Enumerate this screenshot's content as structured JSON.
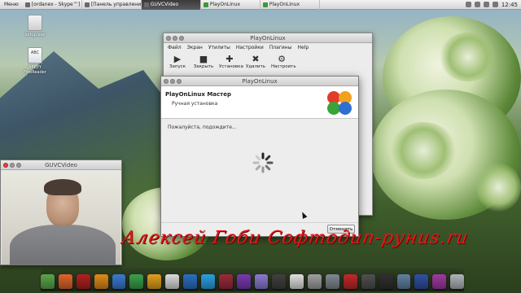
{
  "top_panel": {
    "menu_label": "Меню",
    "tasks": [
      {
        "label": "[ordanex - Skype™]",
        "active": false
      },
      {
        "label": "[Панель управлени...",
        "active": false
      },
      {
        "label": "GUVCVideo",
        "active": true
      },
      {
        "label": "PlayOnLinux",
        "active": false
      },
      {
        "label": "PlayOnLinux",
        "active": false
      }
    ],
    "clock": "12:45"
  },
  "desktop_icons": [
    {
      "label": "setup.exe",
      "color": "#e8e8e8"
    },
    {
      "label": "ABBYY FineReader",
      "color": "#dde3ea"
    }
  ],
  "pol_window": {
    "title": "PlayOnLinux",
    "menu": [
      "Файл",
      "Экран",
      "Утилиты",
      "Настройки",
      "Плагины",
      "Help"
    ],
    "toolbar": [
      {
        "label": "Запуск",
        "icon": "play-icon",
        "glyph": "▶"
      },
      {
        "label": "Закрыть",
        "icon": "stop-icon",
        "glyph": "■"
      },
      {
        "label": "Установка",
        "icon": "plus-icon",
        "glyph": "✚"
      },
      {
        "label": "Удалить",
        "icon": "remove-icon",
        "glyph": "✖"
      },
      {
        "label": "Настроить",
        "icon": "gear-icon",
        "glyph": "⚙"
      }
    ]
  },
  "wizard": {
    "window_title": "PlayOnLinux",
    "heading": "PlayOnLinux Мастер",
    "subheading": "Ручная установка",
    "message": "Пожалуйста, подождите...",
    "cancel_label": "Отменить"
  },
  "guvc_window": {
    "title": "GUVCVideo"
  },
  "watermark_text": "Алексей Гоби Софтодип-руниs.ru",
  "dock_items": [
    {
      "name": "anchor",
      "color": "#5aa64a"
    },
    {
      "name": "firefox",
      "color": "#e0642a"
    },
    {
      "name": "media",
      "color": "#b02020"
    },
    {
      "name": "clementine",
      "color": "#e08a1a"
    },
    {
      "name": "office-doc",
      "color": "#3a7ad0"
    },
    {
      "name": "spreadsheet",
      "color": "#3aa04a"
    },
    {
      "name": "presentation",
      "color": "#e0a020"
    },
    {
      "name": "document",
      "color": "#dcdcdc"
    },
    {
      "name": "mail",
      "color": "#2a70c0"
    },
    {
      "name": "skype",
      "color": "#2aa0e0"
    },
    {
      "name": "wine",
      "color": "#9a2a3a"
    },
    {
      "name": "video",
      "color": "#7a3ab0"
    },
    {
      "name": "pidgin",
      "color": "#8a7ad0"
    },
    {
      "name": "webcam",
      "color": "#404040"
    },
    {
      "name": "music",
      "color": "#e0e0e0"
    },
    {
      "name": "tools",
      "color": "#a0a0a0"
    },
    {
      "name": "settings",
      "color": "#808890"
    },
    {
      "name": "filezilla",
      "color": "#c02a2a"
    },
    {
      "name": "terminal",
      "color": "#505050"
    },
    {
      "name": "player",
      "color": "#303030"
    },
    {
      "name": "monitor",
      "color": "#6080a0"
    },
    {
      "name": "chat",
      "color": "#3050a0"
    },
    {
      "name": "headphones",
      "color": "#a03aa0"
    },
    {
      "name": "trash",
      "color": "#b0b4b8"
    }
  ]
}
